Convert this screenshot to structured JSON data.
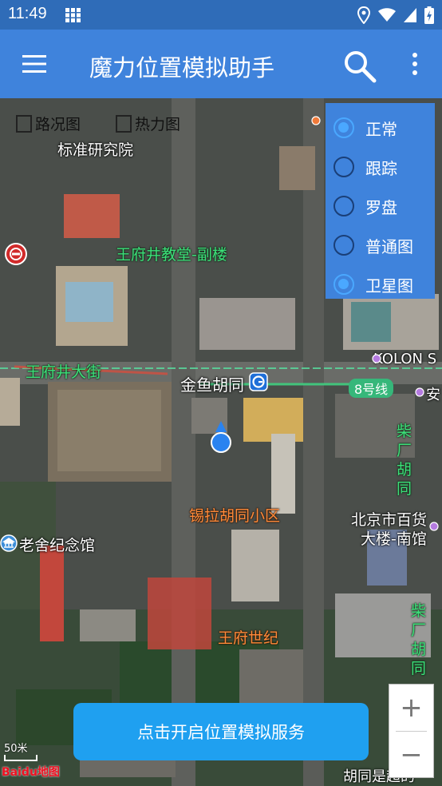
{
  "status_bar": {
    "time": "11:49"
  },
  "app_bar": {
    "title": "魔力位置模拟助手"
  },
  "layer_toggles": [
    {
      "label": "路况图",
      "checked": false
    },
    {
      "label": "热力图",
      "checked": false
    }
  ],
  "map_type_options": [
    {
      "label": "正常",
      "selected": true
    },
    {
      "label": "跟踪",
      "selected": false
    },
    {
      "label": "罗盘",
      "selected": false
    },
    {
      "label": "普通图",
      "selected": false
    },
    {
      "label": "卫星图",
      "selected": true
    }
  ],
  "map_labels": {
    "institute": "标准研究院",
    "church": "王府井教堂-副楼",
    "street": "王府井大街",
    "metro_station": "金鱼胡同",
    "metro_line": "8号线",
    "kolon": "KOLON S",
    "an": "安",
    "hutong_vertical": "柴\n厂\n胡\n同",
    "community": "锡拉胡同小区",
    "department_store_1": "北京市百货",
    "department_store_2": "大楼-南馆",
    "memorial": "老舍纪念馆",
    "right_vertical": "柴\n厂\n胡\n同",
    "wangfu": "王府世纪",
    "bottom_partial": "胡同是超的"
  },
  "start_button": {
    "label": "点击开启位置模拟服务"
  },
  "zoom": {
    "in_label": "+",
    "out_label": "−"
  },
  "scale": {
    "label": "50米"
  },
  "map_logo": "Baidu地图",
  "colors": {
    "app_bar": "#3f83dc",
    "status_bar": "#2f6cb8",
    "start_button": "#1fa0f0",
    "label_green": "#3de07a",
    "label_orange": "#ff8a3a",
    "radio_selected": "#4aa8ff"
  }
}
